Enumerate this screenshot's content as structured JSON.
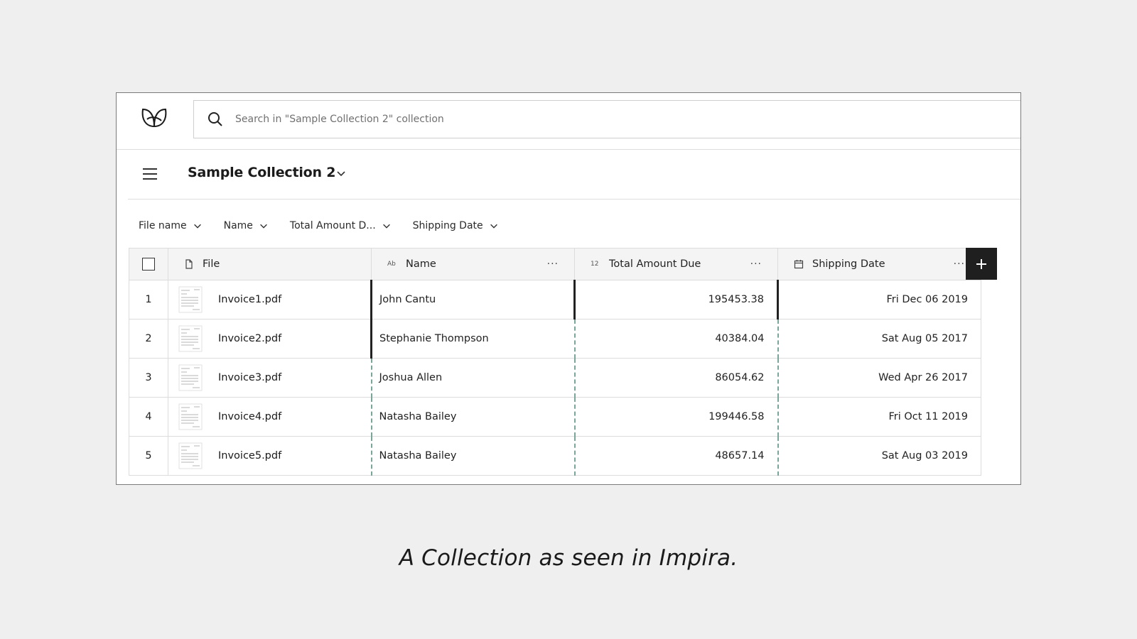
{
  "search": {
    "placeholder": "Search in \"Sample Collection 2\" collection",
    "icon": "search-icon"
  },
  "brand": {
    "icon": "leaf-logo-icon"
  },
  "collection": {
    "title": "Sample Collection 2",
    "menu_icon": "hamburger-menu-icon",
    "dropdown_icon": "chevron-down-icon"
  },
  "filters": [
    {
      "label": "File name"
    },
    {
      "label": "Name"
    },
    {
      "label": "Total Amount D..."
    },
    {
      "label": "Shipping Date"
    }
  ],
  "table": {
    "columns": [
      {
        "label": "File",
        "type_icon": "document-icon"
      },
      {
        "label": "Name",
        "type_icon": "text-type-icon",
        "type_text": "Ab"
      },
      {
        "label": "Total Amount Due",
        "type_icon": "number-type-icon",
        "type_text": "12"
      },
      {
        "label": "Shipping Date",
        "type_icon": "calendar-icon"
      }
    ],
    "more_label": "···",
    "rows": [
      {
        "index": "1",
        "file": "Invoice1.pdf",
        "name": "John Cantu",
        "amount": "195453.38",
        "date": "Fri Dec 06 2019"
      },
      {
        "index": "2",
        "file": "Invoice2.pdf",
        "name": "Stephanie Thompson",
        "amount": "40384.04",
        "date": "Sat Aug 05 2017"
      },
      {
        "index": "3",
        "file": "Invoice3.pdf",
        "name": "Joshua Allen",
        "amount": "86054.62",
        "date": "Wed Apr 26 2017"
      },
      {
        "index": "4",
        "file": "Invoice4.pdf",
        "name": "Natasha Bailey",
        "amount": "199446.58",
        "date": "Fri Oct 11 2019"
      },
      {
        "index": "5",
        "file": "Invoice5.pdf",
        "name": "Natasha Bailey",
        "amount": "48657.14",
        "date": "Sat Aug 03 2019"
      }
    ],
    "add_column_icon": "plus-icon"
  },
  "caption": "A Collection as seen in Impira.",
  "colors": {
    "background": "#efefef",
    "accent_dark": "#1f1f1f",
    "extraction_border": "#7aa59b"
  }
}
